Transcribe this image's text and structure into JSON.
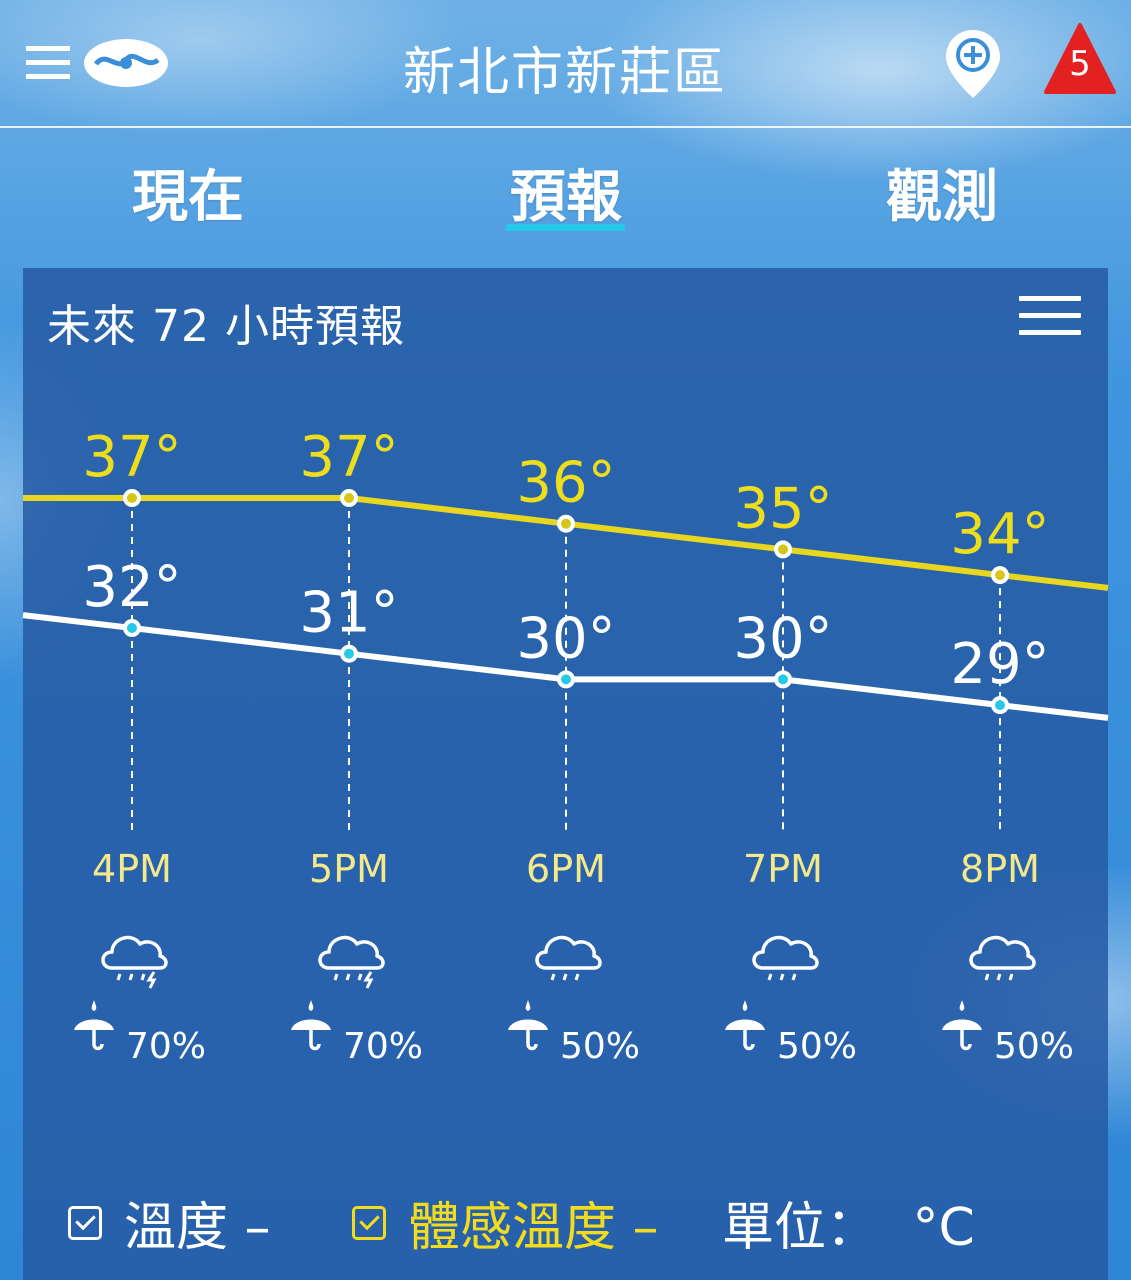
{
  "header": {
    "location": "新北市新莊區",
    "alert_count": "5"
  },
  "tabs": [
    {
      "label": "現在"
    },
    {
      "label": "預報"
    },
    {
      "label": "觀測"
    }
  ],
  "active_tab": 1,
  "card": {
    "title": "未來 72 小時預報"
  },
  "chart_data": {
    "type": "line",
    "x": [
      "4PM",
      "5PM",
      "6PM",
      "7PM",
      "8PM"
    ],
    "series": [
      {
        "name": "體感溫度",
        "color": "#e8d71e",
        "values": [
          37,
          37,
          36,
          35,
          34
        ],
        "labels": [
          "37°",
          "37°",
          "36°",
          "35°",
          "34°"
        ]
      },
      {
        "name": "溫度",
        "color": "#ffffff",
        "values": [
          32,
          31,
          30,
          30,
          29
        ],
        "labels": [
          "32°",
          "31°",
          "30°",
          "30°",
          "29°"
        ]
      }
    ],
    "weather_icons": [
      "cloud-rain-thunder-icon",
      "cloud-rain-thunder-icon",
      "cloud-rain-icon",
      "cloud-rain-icon",
      "cloud-rain-icon"
    ],
    "rain_probability": [
      "70%",
      "70%",
      "50%",
      "50%",
      "50%"
    ]
  },
  "legend": {
    "temp_label": "溫度 –",
    "feels_label": "體感溫度 –",
    "unit_label": "單位：",
    "unit_value": "°C"
  }
}
